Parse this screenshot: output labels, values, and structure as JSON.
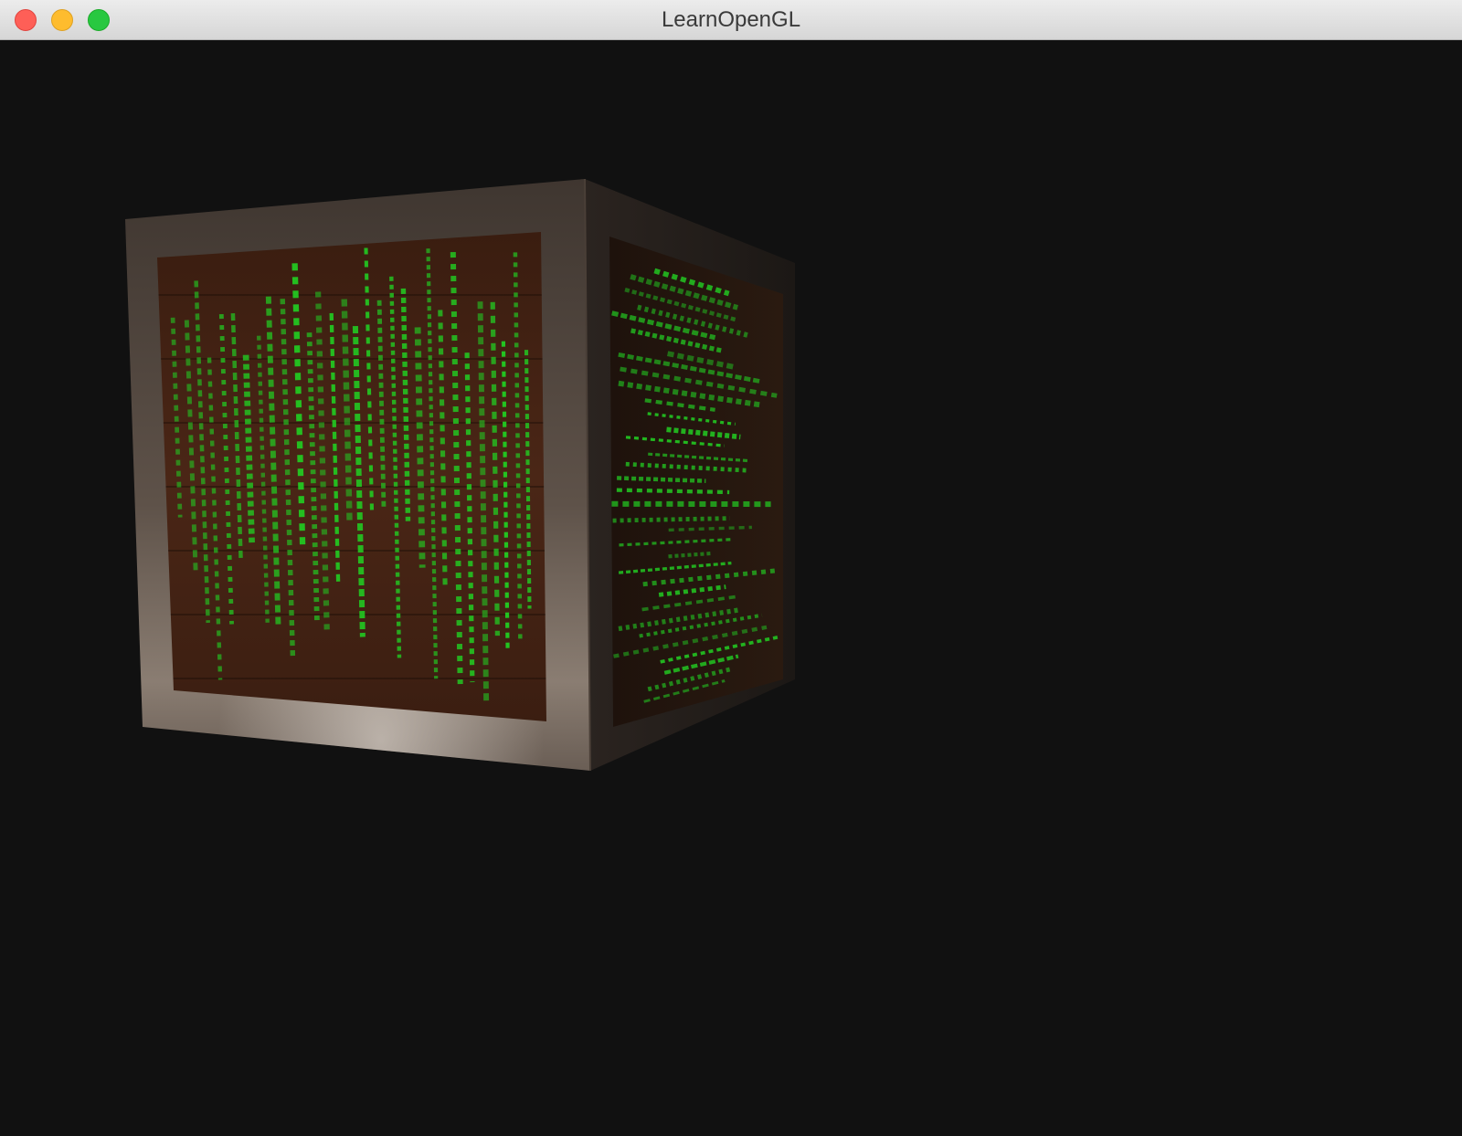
{
  "window": {
    "title": "LearnOpenGL"
  },
  "scene": {
    "background_color": "#111111",
    "object": "textured-cube",
    "crate_frame_color": "#5a4a3e",
    "crate_wood_color": "#3b1f12",
    "emission_color": "#22cc22"
  }
}
